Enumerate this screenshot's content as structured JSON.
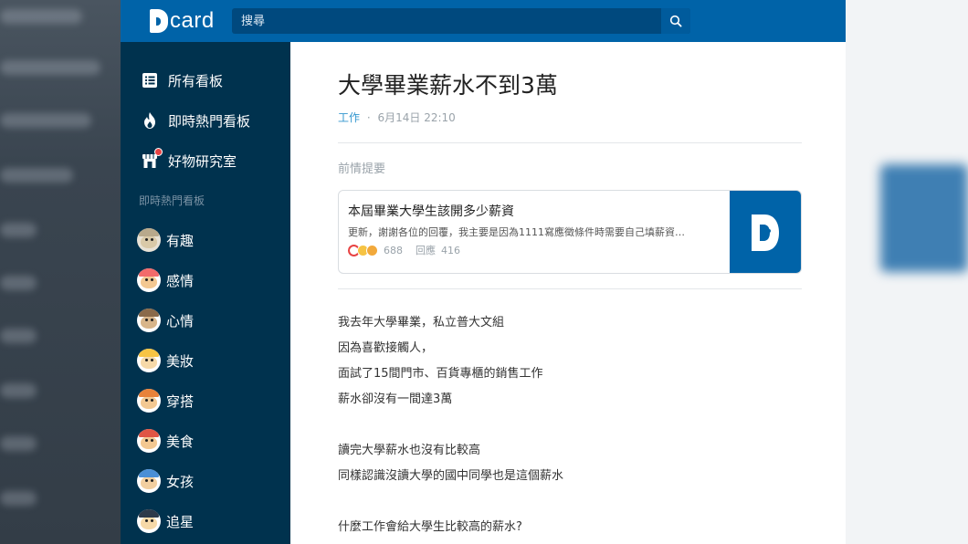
{
  "app": {
    "brand": "card"
  },
  "search": {
    "placeholder": "搜尋"
  },
  "sidebar": {
    "main_items": [
      {
        "label": "所有看板",
        "icon": "list-icon"
      },
      {
        "label": "即時熱門看板",
        "icon": "flame-icon"
      },
      {
        "label": "好物研究室",
        "icon": "shop-icon"
      }
    ],
    "section_heading": "即時熱門看板",
    "forums": [
      {
        "label": "有趣",
        "icon": "forum-avatar-funny"
      },
      {
        "label": "感情",
        "icon": "forum-avatar-relationship"
      },
      {
        "label": "心情",
        "icon": "forum-avatar-mood"
      },
      {
        "label": "美妝",
        "icon": "forum-avatar-makeup"
      },
      {
        "label": "穿搭",
        "icon": "forum-avatar-dressup"
      },
      {
        "label": "美食",
        "icon": "forum-avatar-food"
      },
      {
        "label": "女孩",
        "icon": "forum-avatar-girl"
      },
      {
        "label": "追星",
        "icon": "forum-avatar-idol"
      }
    ]
  },
  "post": {
    "title": "大學畢業薪水不到3萬",
    "forum": "工作",
    "meta_separator": "·",
    "date": "6月14日 22:10",
    "quote_label": "前情提要",
    "quote": {
      "title": "本屆畢業大學生該開多少薪資",
      "excerpt": "更新，謝謝各位的回覆，我主要是因為1111寫應徵條件時需要自己填薪資…",
      "likes": "688",
      "comments_label": "回應",
      "comments": "416"
    },
    "body": [
      "我去年大學畢業，私立普大文組",
      "因為喜歡接觸人，",
      "面試了15間門市、百貨專櫃的銷售工作",
      "薪水卻沒有一間達3萬",
      "",
      "讀完大學薪水也沒有比較高",
      "同樣認識沒讀大學的國中同學也是這個薪水",
      "",
      "什麼工作會給大學生比較高的薪水?"
    ]
  },
  "colors": {
    "brand_blue": "#0063a8",
    "sidebar_bg": "#00324e",
    "link_blue": "#3397cf"
  }
}
